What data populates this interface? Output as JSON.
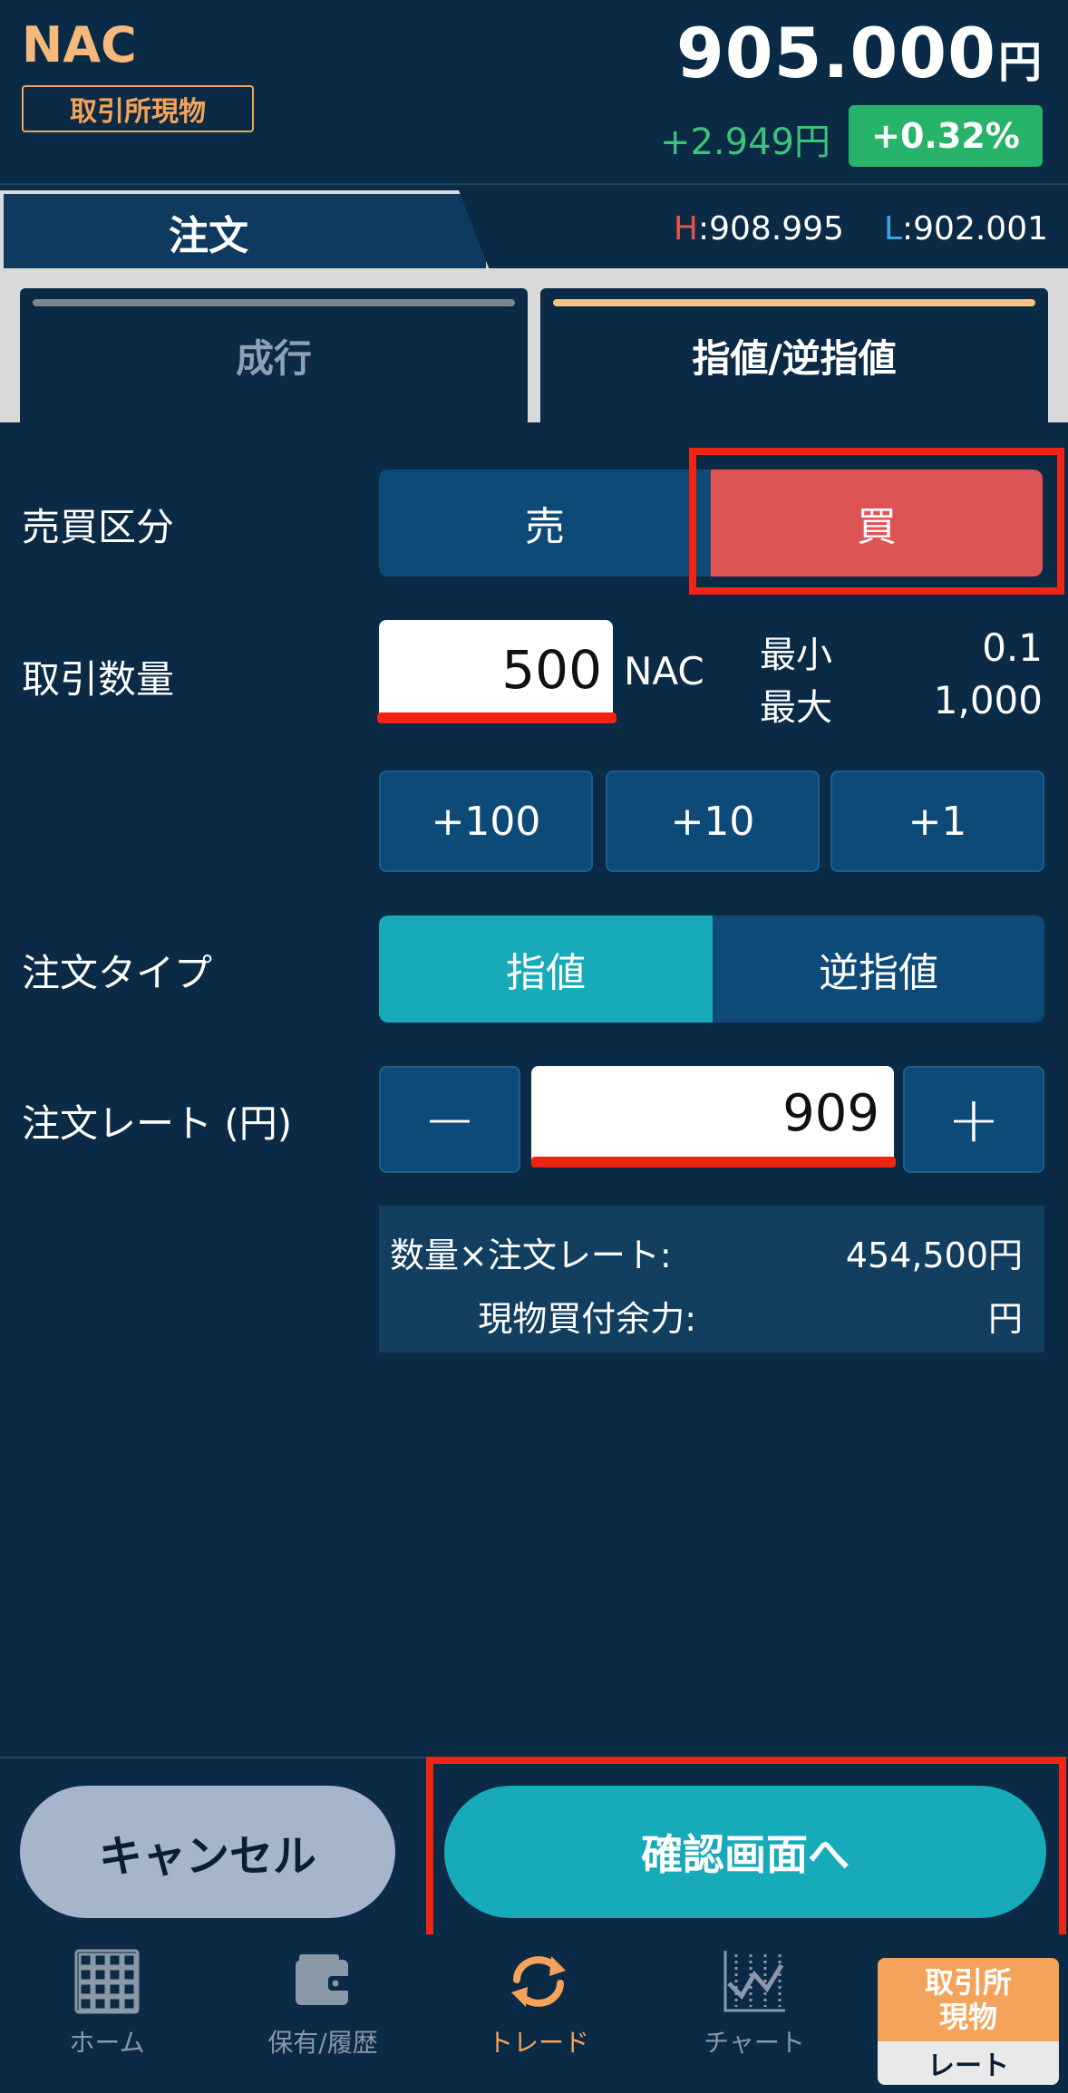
{
  "header": {
    "symbol": "NAC",
    "market_badge": "取引所現物",
    "price": "905.000",
    "price_unit": "円",
    "change": "+2.949円",
    "change_pct": "+0.32%"
  },
  "tabbar": {
    "order_tab": "注文",
    "high_letter": "H",
    "high_value": ":908.995",
    "low_letter": "L",
    "low_value": ":902.001"
  },
  "order_kinds": {
    "market": "成行",
    "limit": "指値/逆指値"
  },
  "form": {
    "side_label": "売買区分",
    "sell": "売",
    "buy": "買",
    "qty_label": "取引数量",
    "qty_value": "500",
    "qty_unit": "NAC",
    "min_label": "最小",
    "min_value": "0.1",
    "max_label": "最大",
    "max_value": "1,000",
    "steps": [
      "+100",
      "+10",
      "+1"
    ],
    "type_label": "注文タイプ",
    "type_limit": "指値",
    "type_stop": "逆指値",
    "rate_label": "注文レート (円)",
    "rate_minus": "−",
    "rate_value": "909",
    "rate_plus": "+",
    "summary_qty_rate_label": "数量×注文レート:",
    "summary_qty_rate_value": "454,500円",
    "summary_buying_power_label": "現物買付余力:",
    "summary_buying_power_value": "円"
  },
  "actions": {
    "cancel": "キャンセル",
    "confirm": "確認画面へ"
  },
  "nav": {
    "home": "ホーム",
    "holdings": "保有/履歴",
    "trade": "トレード",
    "chart": "チャート",
    "rate_top_line1": "取引所",
    "rate_top_line2": "現物",
    "rate_bottom": "レート"
  },
  "colors": {
    "background": "#0b2a45",
    "accent_teal": "#17aab8",
    "buy_red": "#de5454",
    "positive_green": "#27b46a",
    "highlight_red": "#f02414",
    "orange": "#f5a35a"
  }
}
